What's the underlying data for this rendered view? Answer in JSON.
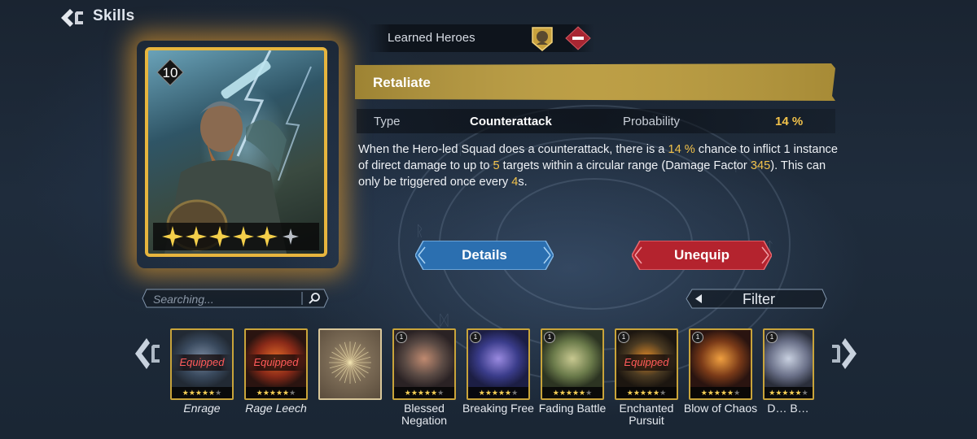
{
  "header": {
    "title": "Skills"
  },
  "hero_card": {
    "level": "10",
    "stars_filled": 5,
    "stars_total": 6
  },
  "learned_heroes": {
    "label": "Learned Heroes"
  },
  "skill": {
    "name": "Retaliate",
    "type_label": "Type",
    "type_value": "Counterattack",
    "probability_label": "Probability",
    "probability_value": "14 %",
    "description": {
      "p1": "When the Hero-led Squad does a counterattack, there is a ",
      "v1": "14 %",
      "p2": " chance to inflict 1 instance of direct damage to up to ",
      "v2": "5",
      "p3": " targets within a circular range (Damage Factor ",
      "v3": "345",
      "p4": "). This can only be triggered once every ",
      "v4": "4",
      "p5": "s."
    }
  },
  "actions": {
    "details_label": "Details",
    "unequip_label": "Unequip"
  },
  "search": {
    "placeholder": "Searching..."
  },
  "filter": {
    "label": "Filter"
  },
  "skill_list": [
    {
      "name": "Enrage",
      "equipped": true,
      "equipped_label": "Equipped",
      "stars_filled": 5,
      "colors": [
        "#3a4a5e",
        "#7a8aa0",
        "#222a34"
      ]
    },
    {
      "name": "Rage Leech",
      "equipped": true,
      "equipped_label": "Equipped",
      "stars_filled": 5,
      "colors": [
        "#8a2a18",
        "#e06a28",
        "#2a1410"
      ]
    },
    {
      "name": "",
      "equipped": false,
      "placeholder": true,
      "stars_filled": 0,
      "colors": [
        "#7a6a55",
        "#b8a27a",
        "#5a4c3c"
      ]
    },
    {
      "name": "Blessed Negation",
      "rarity": "1",
      "equipped": false,
      "stars_filled": 5,
      "colors": [
        "#5a4a44",
        "#c08a70",
        "#2a2224"
      ]
    },
    {
      "name": "Breaking Free",
      "rarity": "1",
      "equipped": false,
      "stars_filled": 5,
      "colors": [
        "#3a3c8a",
        "#9a8ae0",
        "#1c1e44"
      ]
    },
    {
      "name": "Fading Battle",
      "rarity": "1",
      "equipped": false,
      "stars_filled": 5,
      "colors": [
        "#6a7a4a",
        "#c8c890",
        "#2c3422"
      ]
    },
    {
      "name": "Enchanted Pursuit",
      "rarity": "1",
      "equipped": true,
      "equipped_label": "Equipped",
      "stars_filled": 5,
      "colors": [
        "#4a3a22",
        "#e08a28",
        "#1c1610"
      ]
    },
    {
      "name": "Blow of Chaos",
      "rarity": "1",
      "equipped": false,
      "stars_filled": 5,
      "colors": [
        "#7a3a18",
        "#f0a040",
        "#2a1410"
      ]
    },
    {
      "name": "D… B…",
      "rarity": "1",
      "equipped": false,
      "stars_filled": 5,
      "colors": [
        "#6a7088",
        "#c8d0e0",
        "#2a2e3a"
      ]
    }
  ],
  "colors": {
    "gold": "#e7b53e",
    "highlight": "#f2c24a",
    "equipped_red": "#ff5a5a",
    "details_blue": "#2b6fb0",
    "unequip_red": "#b4232e"
  }
}
